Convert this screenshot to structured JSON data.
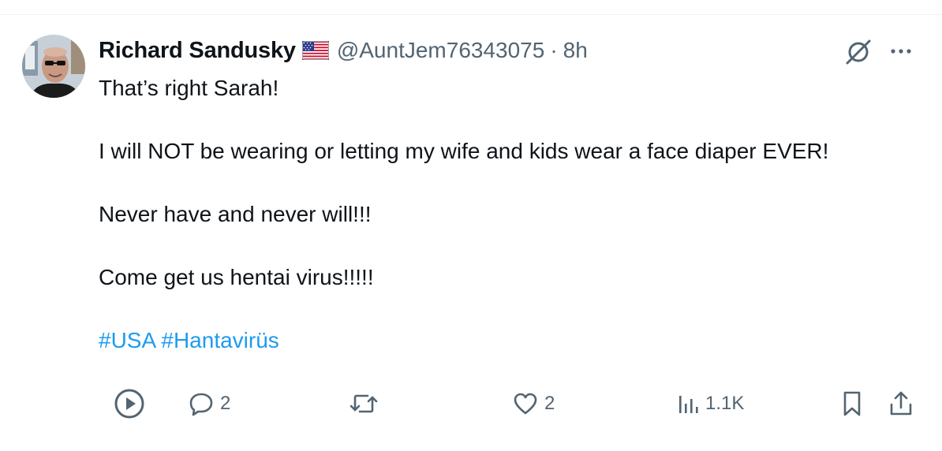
{
  "tweet": {
    "author": {
      "display_name": "Richard Sandusky",
      "handle": "@AuntJem76343075",
      "flag_icon": "us-flag-icon",
      "avatar_icon": "avatar-photo"
    },
    "separator": "·",
    "time": "8h",
    "paragraphs": [
      "That’s right Sarah!",
      "I will NOT be wearing or letting my wife and kids wear a face diaper EVER!",
      "Never have and never will!!!",
      "Come get us hentai virus!!!!!"
    ],
    "hashtags": [
      "#USA",
      "#Hantavirüs"
    ]
  },
  "actions": {
    "play": {
      "icon": "play-icon"
    },
    "reply": {
      "icon": "reply-icon",
      "count": "2"
    },
    "repost": {
      "icon": "repost-icon"
    },
    "like": {
      "icon": "heart-icon",
      "count": "2"
    },
    "views": {
      "icon": "views-icon",
      "count": "1.1K"
    },
    "bookmark": {
      "icon": "bookmark-icon"
    },
    "share": {
      "icon": "share-icon"
    }
  },
  "header_actions": {
    "grok": {
      "icon": "grok-icon"
    },
    "more": {
      "icon": "more-icon"
    }
  },
  "colors": {
    "text": "#0f1419",
    "secondary": "#536471",
    "link": "#1d9bf0",
    "divider": "#eff3f4"
  }
}
